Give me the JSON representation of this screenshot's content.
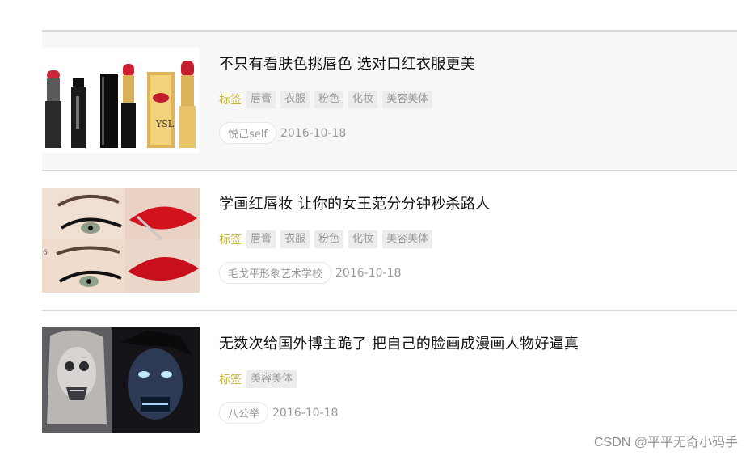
{
  "articles": [
    {
      "title": "不只有看肤色挑唇色 选对口红衣服更美",
      "tags_label": "标签",
      "tags": [
        "唇膏",
        "衣服",
        "粉色",
        "化妆",
        "美容美体"
      ],
      "author": "悦己self",
      "date": "2016-10-18",
      "thumb_icon": "lipstick-photo"
    },
    {
      "title": "学画红唇妆 让你的女王范分分钟秒杀路人",
      "tags_label": "标签",
      "tags": [
        "唇膏",
        "衣服",
        "粉色",
        "化妆",
        "美容美体"
      ],
      "author": "毛戈平形象艺术学校",
      "date": "2016-10-18",
      "thumb_icon": "eye-lip-makeup-photo"
    },
    {
      "title": "无数次给国外博主跪了 把自己的脸画成漫画人物好逼真",
      "tags_label": "标签",
      "tags": [
        "美容美体"
      ],
      "author": "八公举",
      "date": "2016-10-18",
      "thumb_icon": "face-paint-photo"
    }
  ],
  "watermark": "CSDN @平平无奇小码手",
  "colors": {
    "tag_label": "#c9b43a",
    "highlight_row": "#f7f7f7",
    "divider": "#d8d8d8"
  }
}
